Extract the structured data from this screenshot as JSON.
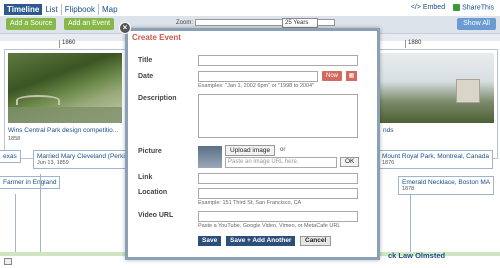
{
  "nav": {
    "tabs": [
      "Timeline",
      "List",
      "Flipbook",
      "Map"
    ],
    "embed_label": "</> Embed",
    "share_label": "ShareThis"
  },
  "toolbar": {
    "add_source_label": "Add a Source",
    "add_event_label": "Add an Event",
    "zoom_label": "Zoom:",
    "zoom_value": "25 Years",
    "show_all_label": "Show All"
  },
  "timeline": {
    "tick_left": "1860",
    "tick_right": "1880",
    "cards": [
      {
        "caption": "Wins Central Park design competitio...",
        "sub": "1858"
      },
      {
        "caption": "nds",
        "sub": ""
      }
    ],
    "events": [
      {
        "title": "exas",
        "sub": ""
      },
      {
        "title": "Married Mary Cleveland (Perkins)",
        "sub": "Jun 13, 1859"
      },
      {
        "title": "Farmer in England",
        "sub": ""
      },
      {
        "title": "Mount Royal Park, Montreal, Canada",
        "sub": "1876"
      },
      {
        "title": "Emerald Necklace, Boston MA",
        "sub": "1878"
      }
    ],
    "bottom_title": "ck Law Olmsted"
  },
  "modal": {
    "title": "Create Event",
    "close_symbol": "×",
    "fields": {
      "title_label": "Title",
      "date_label": "Date",
      "date_hint": "Examples: \"Jan 1, 2002 6pm\" or \"1998 to 2004\"",
      "now_label": "Now",
      "description_label": "Description",
      "picture_label": "Picture",
      "upload_label": "Upload image",
      "or_text": "or",
      "url_placeholder": "Paste an image URL here.",
      "ok_label": "OK",
      "link_label": "Link",
      "location_label": "Location",
      "location_hint": "Example: 151 Third St, San Francisco, CA",
      "video_label": "Video URL",
      "video_hint": "Paste a YouTube, Google Video, Vimeo, or MetaCafe URL"
    },
    "buttons": {
      "save": "Save",
      "save_add": "Save + Add Another",
      "cancel": "Cancel"
    }
  }
}
